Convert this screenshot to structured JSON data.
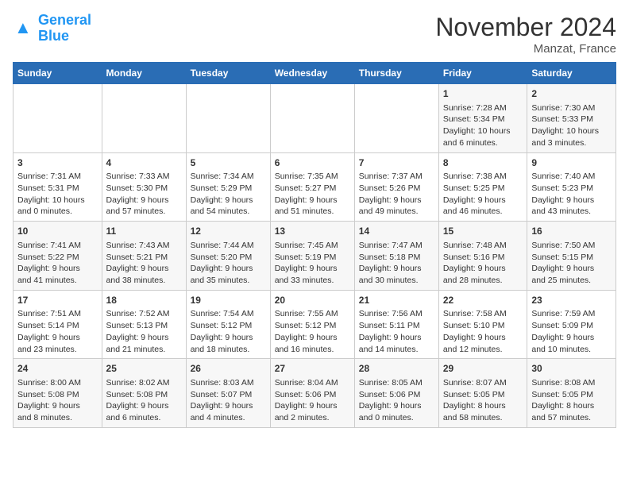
{
  "logo": {
    "line1": "General",
    "line2": "Blue"
  },
  "title": "November 2024",
  "subtitle": "Manzat, France",
  "days_of_week": [
    "Sunday",
    "Monday",
    "Tuesday",
    "Wednesday",
    "Thursday",
    "Friday",
    "Saturday"
  ],
  "weeks": [
    [
      {
        "day": "",
        "content": ""
      },
      {
        "day": "",
        "content": ""
      },
      {
        "day": "",
        "content": ""
      },
      {
        "day": "",
        "content": ""
      },
      {
        "day": "",
        "content": ""
      },
      {
        "day": "1",
        "content": "Sunrise: 7:28 AM\nSunset: 5:34 PM\nDaylight: 10 hours\nand 6 minutes."
      },
      {
        "day": "2",
        "content": "Sunrise: 7:30 AM\nSunset: 5:33 PM\nDaylight: 10 hours\nand 3 minutes."
      }
    ],
    [
      {
        "day": "3",
        "content": "Sunrise: 7:31 AM\nSunset: 5:31 PM\nDaylight: 10 hours\nand 0 minutes."
      },
      {
        "day": "4",
        "content": "Sunrise: 7:33 AM\nSunset: 5:30 PM\nDaylight: 9 hours\nand 57 minutes."
      },
      {
        "day": "5",
        "content": "Sunrise: 7:34 AM\nSunset: 5:29 PM\nDaylight: 9 hours\nand 54 minutes."
      },
      {
        "day": "6",
        "content": "Sunrise: 7:35 AM\nSunset: 5:27 PM\nDaylight: 9 hours\nand 51 minutes."
      },
      {
        "day": "7",
        "content": "Sunrise: 7:37 AM\nSunset: 5:26 PM\nDaylight: 9 hours\nand 49 minutes."
      },
      {
        "day": "8",
        "content": "Sunrise: 7:38 AM\nSunset: 5:25 PM\nDaylight: 9 hours\nand 46 minutes."
      },
      {
        "day": "9",
        "content": "Sunrise: 7:40 AM\nSunset: 5:23 PM\nDaylight: 9 hours\nand 43 minutes."
      }
    ],
    [
      {
        "day": "10",
        "content": "Sunrise: 7:41 AM\nSunset: 5:22 PM\nDaylight: 9 hours\nand 41 minutes."
      },
      {
        "day": "11",
        "content": "Sunrise: 7:43 AM\nSunset: 5:21 PM\nDaylight: 9 hours\nand 38 minutes."
      },
      {
        "day": "12",
        "content": "Sunrise: 7:44 AM\nSunset: 5:20 PM\nDaylight: 9 hours\nand 35 minutes."
      },
      {
        "day": "13",
        "content": "Sunrise: 7:45 AM\nSunset: 5:19 PM\nDaylight: 9 hours\nand 33 minutes."
      },
      {
        "day": "14",
        "content": "Sunrise: 7:47 AM\nSunset: 5:18 PM\nDaylight: 9 hours\nand 30 minutes."
      },
      {
        "day": "15",
        "content": "Sunrise: 7:48 AM\nSunset: 5:16 PM\nDaylight: 9 hours\nand 28 minutes."
      },
      {
        "day": "16",
        "content": "Sunrise: 7:50 AM\nSunset: 5:15 PM\nDaylight: 9 hours\nand 25 minutes."
      }
    ],
    [
      {
        "day": "17",
        "content": "Sunrise: 7:51 AM\nSunset: 5:14 PM\nDaylight: 9 hours\nand 23 minutes."
      },
      {
        "day": "18",
        "content": "Sunrise: 7:52 AM\nSunset: 5:13 PM\nDaylight: 9 hours\nand 21 minutes."
      },
      {
        "day": "19",
        "content": "Sunrise: 7:54 AM\nSunset: 5:12 PM\nDaylight: 9 hours\nand 18 minutes."
      },
      {
        "day": "20",
        "content": "Sunrise: 7:55 AM\nSunset: 5:12 PM\nDaylight: 9 hours\nand 16 minutes."
      },
      {
        "day": "21",
        "content": "Sunrise: 7:56 AM\nSunset: 5:11 PM\nDaylight: 9 hours\nand 14 minutes."
      },
      {
        "day": "22",
        "content": "Sunrise: 7:58 AM\nSunset: 5:10 PM\nDaylight: 9 hours\nand 12 minutes."
      },
      {
        "day": "23",
        "content": "Sunrise: 7:59 AM\nSunset: 5:09 PM\nDaylight: 9 hours\nand 10 minutes."
      }
    ],
    [
      {
        "day": "24",
        "content": "Sunrise: 8:00 AM\nSunset: 5:08 PM\nDaylight: 9 hours\nand 8 minutes."
      },
      {
        "day": "25",
        "content": "Sunrise: 8:02 AM\nSunset: 5:08 PM\nDaylight: 9 hours\nand 6 minutes."
      },
      {
        "day": "26",
        "content": "Sunrise: 8:03 AM\nSunset: 5:07 PM\nDaylight: 9 hours\nand 4 minutes."
      },
      {
        "day": "27",
        "content": "Sunrise: 8:04 AM\nSunset: 5:06 PM\nDaylight: 9 hours\nand 2 minutes."
      },
      {
        "day": "28",
        "content": "Sunrise: 8:05 AM\nSunset: 5:06 PM\nDaylight: 9 hours\nand 0 minutes."
      },
      {
        "day": "29",
        "content": "Sunrise: 8:07 AM\nSunset: 5:05 PM\nDaylight: 8 hours\nand 58 minutes."
      },
      {
        "day": "30",
        "content": "Sunrise: 8:08 AM\nSunset: 5:05 PM\nDaylight: 8 hours\nand 57 minutes."
      }
    ]
  ]
}
